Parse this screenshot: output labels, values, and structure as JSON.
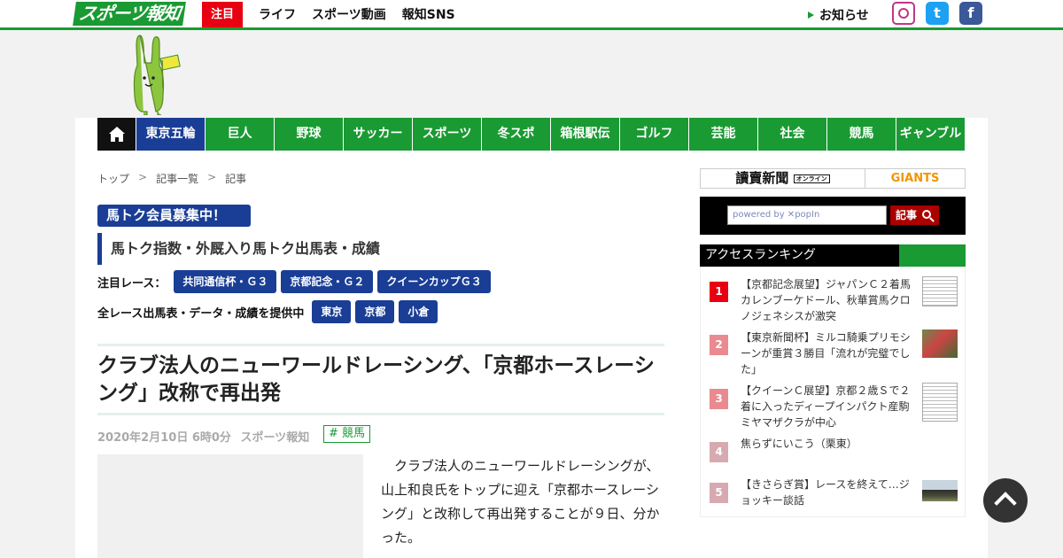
{
  "header": {
    "logo_text": "スポーツ報知",
    "hot_label": "注目",
    "nav": [
      "ライフ",
      "スポーツ動画",
      "報知SNS"
    ],
    "notice_label": "お知らせ",
    "sns": [
      {
        "name": "instagram",
        "icon": "instagram-icon",
        "glyph": ""
      },
      {
        "name": "twitter",
        "icon": "twitter-icon",
        "glyph": "t"
      },
      {
        "name": "facebook",
        "icon": "facebook-icon",
        "glyph": "f"
      }
    ]
  },
  "categories": [
    {
      "label": "東京五輪",
      "active": true
    },
    {
      "label": "巨人",
      "active": false
    },
    {
      "label": "野球",
      "active": false
    },
    {
      "label": "サッカー",
      "active": false
    },
    {
      "label": "スポーツ",
      "active": false
    },
    {
      "label": "冬スポ",
      "active": false
    },
    {
      "label": "箱根駅伝",
      "active": false
    },
    {
      "label": "ゴルフ",
      "active": false
    },
    {
      "label": "芸能",
      "active": false
    },
    {
      "label": "社会",
      "active": false
    },
    {
      "label": "競馬",
      "active": false
    },
    {
      "label": "ギャンブル",
      "active": false
    }
  ],
  "breadcrumb": [
    "トップ",
    "記事一覧",
    "記事"
  ],
  "promo": {
    "title": "馬トク会員募集中！",
    "subtitle": "馬トク指数・外厩入り馬トク出馬表・成績",
    "featured_label": "注目レース：",
    "featured_races": [
      "共同通信杯・Ｇ３",
      "京都記念・Ｇ２",
      "クイーンカップＧ３"
    ],
    "all_label": "全レース出馬表・データ・成績を提供中",
    "venues": [
      "東京",
      "京都",
      "小倉"
    ]
  },
  "article": {
    "headline": "クラブ法人のニューワールドレーシング、「京都ホースレーシング」改称で再出発",
    "date": "2020年2月10日 6時0分",
    "source": "スポーツ報知",
    "tag": "# 競馬",
    "body": "クラブ法人のニューワールドレーシングが、山上和良氏をトップに迎え「京都ホースレーシング」と改称して再出発することが９日、分かった。"
  },
  "sidebar": {
    "banner_left": "讀賣新聞",
    "banner_left_sub": "オンライン",
    "banner_right": "GIANTS",
    "search_placeholder": "powered by ✕popIn",
    "search_button": "記事",
    "ranking_title": "アクセスランキング",
    "ranking": [
      {
        "rank": "1",
        "text": "【京都記念展望】ジャパンＣ２着馬カレンブーケドール、秋華賞馬クロノジェネシスが激突",
        "color": "#e60012",
        "thumb": "doc"
      },
      {
        "rank": "2",
        "text": "【東京新聞杯】ミルコ騎乗プリモシーンが重賞３勝目「流れが完璧でした」",
        "color": "#e88a8f",
        "thumb": "photo"
      },
      {
        "rank": "3",
        "text": "【クイーンＣ展望】京都２歳Ｓで２着に入ったディープインパクト産駒ミヤマザクラが中心",
        "color": "#e88a8f",
        "thumb": "doc"
      },
      {
        "rank": "4",
        "text": "焦らずにいこう（栗東）",
        "color": "#d6aab0",
        "thumb": "none"
      },
      {
        "rank": "5",
        "text": "【きさらぎ賞】レースを終えて…ジョッキー談話",
        "color": "#d6aab0",
        "thumb": "race"
      }
    ]
  },
  "colors": {
    "brand_green": "#1a9a33",
    "navy": "#1a3e95",
    "red": "#e60012"
  }
}
